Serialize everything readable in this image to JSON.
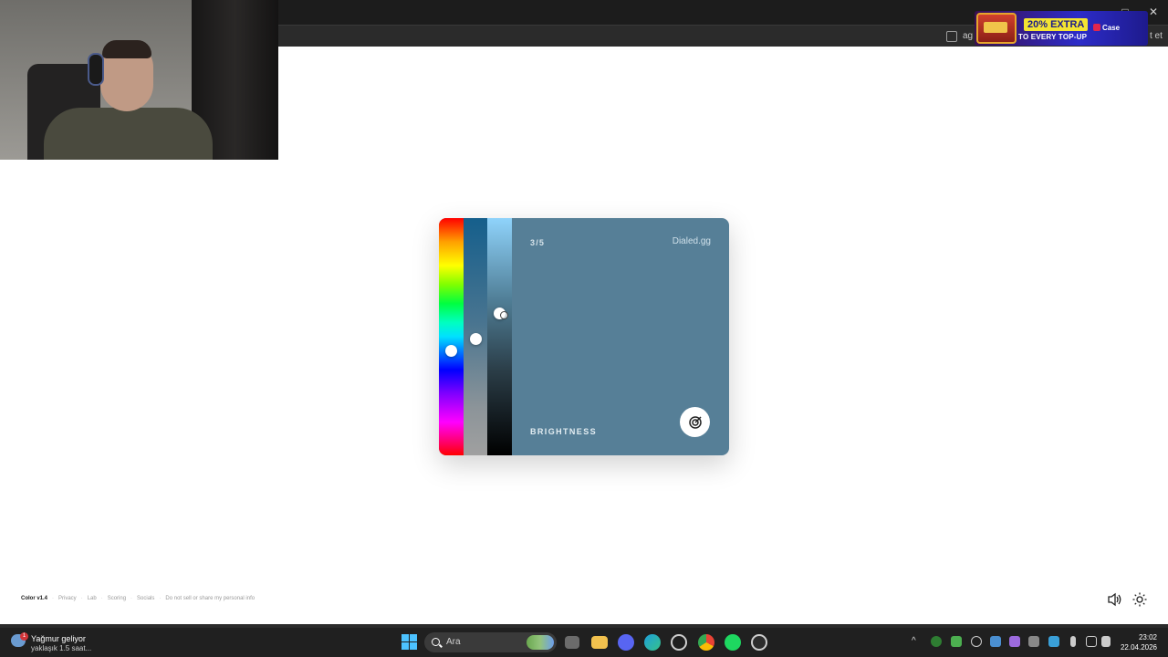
{
  "browser": {
    "bar_text": "ag",
    "bar_text_right": "t et"
  },
  "promo": {
    "extra": "20% EXTRA",
    "topup": "TO EVERY TOP-UP",
    "brand": "Case"
  },
  "card": {
    "step": "3/5",
    "brand": "Dialed.gg",
    "mode": "BRIGHTNESS",
    "color": "#567f97",
    "hue_position": 0.56,
    "saturation_position": 0.51,
    "brightness_position": 0.4
  },
  "footer": {
    "version": "Color v1.4",
    "links": [
      "Privacy",
      "Lab",
      "Scoring",
      "Socials",
      "Do not sell or share my personal info"
    ]
  },
  "taskbar": {
    "weather_title": "Yağmur geliyor",
    "weather_sub": "yaklaşık 1.5 saat...",
    "weather_badge": "1",
    "search_placeholder": "Ara",
    "time": "23:02",
    "date": "22.04.2026",
    "apps": [
      "windows-start-icon",
      "file-explorer-icon",
      "folder-icon",
      "discord-icon",
      "edge-icon",
      "app-icon",
      "chrome-icon",
      "spotify-icon",
      "app-arrow-icon"
    ]
  }
}
